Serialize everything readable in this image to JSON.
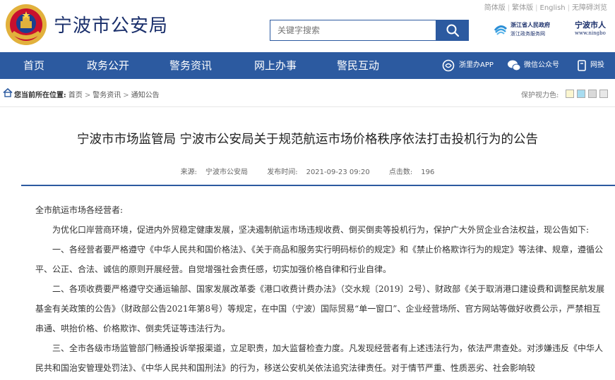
{
  "header": {
    "site_title": "宁波市公安局",
    "lang_links": [
      "简体版",
      "繁体版",
      "English",
      "无障碍浏览"
    ],
    "search_placeholder": "关键字搜索",
    "gov_logo_line1": "浙江省人民政府",
    "gov_logo_line2": "浙江政务服务网",
    "city_logo_line1": "宁波市人",
    "city_logo_line2": "www.ningbo"
  },
  "nav": {
    "items": [
      "首页",
      "政务公开",
      "警务资讯",
      "网上办事",
      "警民互动"
    ],
    "extras": [
      "浙里办APP",
      "微信公众号",
      "网投"
    ]
  },
  "breadcrumb": {
    "label": "您当前所在位置:",
    "items": [
      "首页",
      "警务资讯",
      "通知公告"
    ],
    "eye_care_label": "保护视力色:"
  },
  "colors": {
    "primary": "#2c5aa0",
    "swatches": [
      "#fbf6d0",
      "#a8dcf0",
      "#d9d9d9",
      "#e8e8e8"
    ]
  },
  "article": {
    "title": "宁波市市场监管局 宁波市公安局关于规范航运市场价格秩序依法打击投机行为的公告",
    "source_label": "来源:",
    "source": "宁波市公安局",
    "time_label": "发布时间:",
    "time": "2021-09-23 09:20",
    "views_label": "点击数:",
    "views": "196",
    "paragraphs": [
      "全市航运市场各经营者:",
      "为优化口岸营商环境，促进内外贸稳定健康发展，坚决遏制航运市场违规收费、倒买倒卖等投机行为，保护广大外贸企业合法权益，现公告如下:",
      "一、各经营者要严格遵守《中华人民共和国价格法》、《关于商品和服务实行明码标价的规定》和《禁止价格欺诈行为的规定》等法律、规章，遵循公平、公正、合法、诚信的原则开展经营。自觉增强社会责任感，切实加强价格自律和行业自律。",
      "二、各项收费要严格遵守交通运输部、国家发展改革委《港口收费计费办法》（交水规〔2019〕2号）、财政部《关于取消港口建设费和调整民航发展基金有关政策的公告》（财政部公告2021年第8号）等规定，在中国（宁波）国际贸易“单一窗口”、企业经营场所、官方网站等做好收费公示，严禁相互串通、哄抬价格、价格欺诈、倒卖凭证等违法行为。",
      "三、全市各级市场监管部门畅通投诉举报渠道，立足职责，加大监督检查力度。凡发现经营者有上述违法行为，依法严肃查处。对涉嫌违反《中华人民共和国治安管理处罚法》、《中华人民共和国刑法》的行为，移送公安机关依法追究法律责任。对于情节严重、性质恶劣、社会影响较"
    ]
  }
}
